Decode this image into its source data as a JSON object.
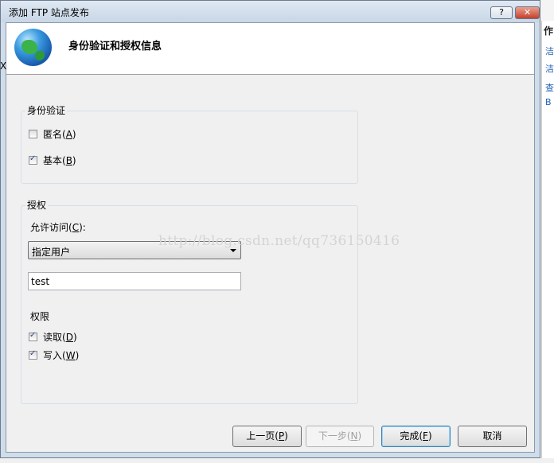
{
  "dialog": {
    "title": "添加 FTP 站点发布",
    "help_button": "?",
    "close_button": "✕",
    "header_title": "身份验证和授权信息"
  },
  "background_app": {
    "panel_title": "作",
    "link_1": "洁",
    "link_2": "洁",
    "link_3": "查",
    "link_4": "B",
    "close_glyph": "X"
  },
  "authentication": {
    "group_label": "身份验证",
    "anonymous": {
      "label": "匿名(",
      "key": "A",
      "suffix": ")",
      "checked": false
    },
    "basic": {
      "label": "基本(",
      "key": "B",
      "suffix": ")",
      "checked": true
    }
  },
  "authorization": {
    "group_label": "授权",
    "allow_access_label": "允许访问(",
    "allow_access_key": "C",
    "allow_access_suffix": "):",
    "allow_access_value": "指定用户",
    "user_value": "test",
    "permissions_label": "权限",
    "read": {
      "label": "读取(",
      "key": "D",
      "suffix": ")",
      "checked": true
    },
    "write": {
      "label": "写入(",
      "key": "W",
      "suffix": ")",
      "checked": true
    }
  },
  "watermark": "http://blog.csdn.net/qq736150416",
  "buttons": {
    "previous": {
      "label": "上一页(",
      "key": "P",
      "suffix": ")"
    },
    "next": {
      "label": "下一步(",
      "key": "N",
      "suffix": ")"
    },
    "finish": {
      "label": "完成(",
      "key": "F",
      "suffix": ")"
    },
    "cancel": "取消"
  },
  "colors": {
    "client_bg": "#f0f0f0",
    "title_bar": "#c8d6e6",
    "check_color": "#2c4a86"
  }
}
